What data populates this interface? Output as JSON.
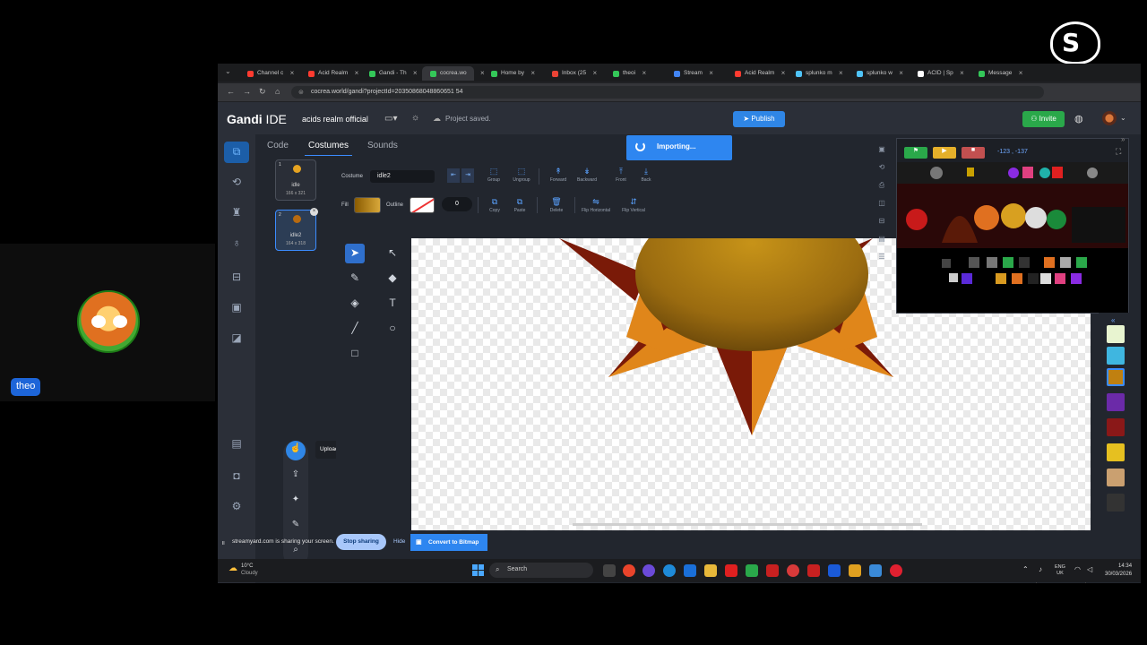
{
  "streamyard": {
    "brand": "streamyard",
    "logo_letter": "S",
    "participant_name": "theo",
    "sharing_text": "streamyard.com is sharing your screen.",
    "stop_sharing_label": "Stop sharing",
    "hide_label": "Hide"
  },
  "browser": {
    "tabs": [
      {
        "label": "Channel c",
        "color": "#ff3b30"
      },
      {
        "label": "Acid Realm",
        "color": "#ff3b30"
      },
      {
        "label": "Gandi - Th",
        "color": "#34c759"
      },
      {
        "label": "cocrea.wo",
        "color": "#34c759",
        "active": true
      },
      {
        "label": "Home by",
        "color": "#34c759"
      },
      {
        "label": "Inbox (25",
        "color": "#ea4335"
      },
      {
        "label": "theoi",
        "color": "#34c759"
      },
      {
        "label": "Stream",
        "color": "#4285f4"
      },
      {
        "label": "Acid Realm",
        "color": "#ff3b30"
      },
      {
        "label": "splunko m",
        "color": "#4fc3f7"
      },
      {
        "label": "splunko w",
        "color": "#4fc3f7"
      },
      {
        "label": "ACID | Sp",
        "color": "#ffffff"
      },
      {
        "label": "Message",
        "color": "#34c759"
      }
    ],
    "url": "cocrea.world/gandi?projectId=20350868048860651 54"
  },
  "gandi": {
    "logo_bold": "Gandi",
    "logo_light": " IDE",
    "project_name": "acids realm official",
    "save_status": "Project saved.",
    "publish_label": "Publish",
    "invite_label": "Invite",
    "tabs": {
      "code": "Code",
      "costumes": "Costumes",
      "sounds": "Sounds"
    },
    "importing_label": "Importing...",
    "costume_label": "Costume",
    "costume_name": "idle2",
    "fill_label": "Fill",
    "outline_label": "Outline",
    "outline_width": "0",
    "toolbar_buttons": {
      "group": "Group",
      "ungroup": "Ungroup",
      "forward": "Forward",
      "backward": "Backward",
      "front": "Front",
      "back": "Back",
      "copy": "Copy",
      "paste": "Paste",
      "delete": "Delete",
      "flip_horizontal": "Flip Horizontal",
      "flip_vertical": "Flip Vertical"
    },
    "costumes": [
      {
        "num": "1",
        "name": "idle",
        "size": "166 x 321"
      },
      {
        "num": "2",
        "name": "idle2",
        "size": "164 x 318"
      }
    ],
    "upload_tooltip": "Upload HD Image",
    "convert_label": "Convert to Bitmap",
    "stage_coords": "-123 , -137",
    "colors": {
      "accent": "#2f86e6",
      "invite": "#2aa84a",
      "sun_orange": "#e0861a",
      "sun_dark": "#7a1a08"
    }
  },
  "taskbar": {
    "temperature": "10°C",
    "weather": "Cloudy",
    "search_placeholder": "Search",
    "lang_1": "ENG",
    "lang_2": "UK",
    "time": "14:34",
    "date": "30/03/2026"
  }
}
